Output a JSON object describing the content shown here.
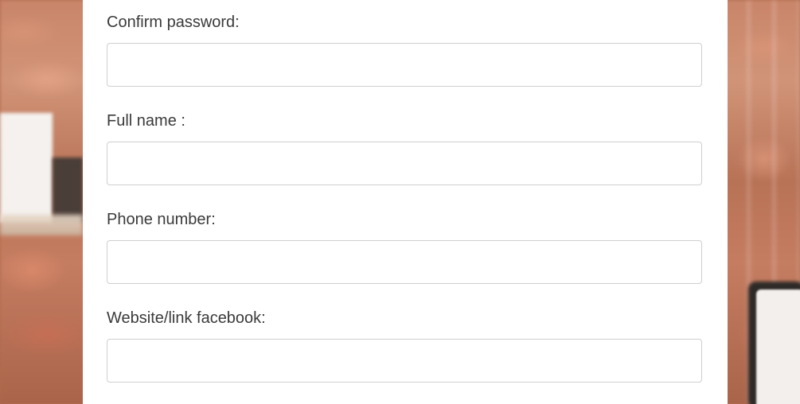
{
  "form": {
    "fields": [
      {
        "label": "Confirm password:",
        "value": "",
        "placeholder": ""
      },
      {
        "label": "Full name :",
        "value": "",
        "placeholder": ""
      },
      {
        "label": "Phone number:",
        "value": "",
        "placeholder": ""
      },
      {
        "label": "Website/link facebook:",
        "value": "",
        "placeholder": ""
      }
    ]
  },
  "colors": {
    "panel_background": "#ffffff",
    "label_text": "#3a3a3a",
    "input_border": "#cfcfcf"
  }
}
